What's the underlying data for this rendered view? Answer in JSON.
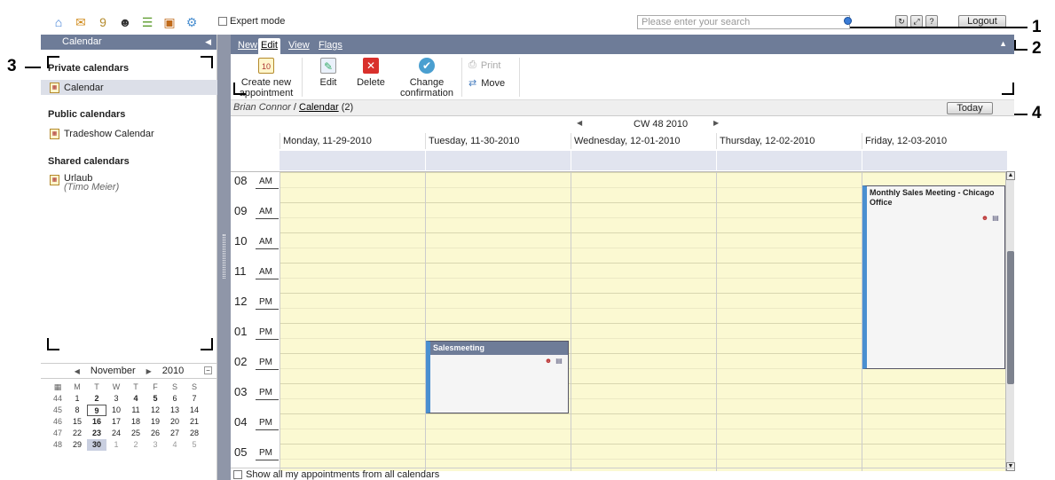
{
  "topbar": {
    "apps": [
      {
        "name": "home-icon",
        "glyph": "⌂",
        "color": "#3a7bd5"
      },
      {
        "name": "mail-icon",
        "glyph": "✉",
        "color": "#d08a1a"
      },
      {
        "name": "calendar-icon",
        "glyph": "9",
        "color": "#b48a2c"
      },
      {
        "name": "contacts-icon",
        "glyph": "☻",
        "color": "#333"
      },
      {
        "name": "tasks-icon",
        "glyph": "☰",
        "color": "#5a9a2a"
      },
      {
        "name": "infostore-icon",
        "glyph": "▣",
        "color": "#c06a1a"
      },
      {
        "name": "settings-icon",
        "glyph": "⚙",
        "color": "#4a8fd0"
      }
    ],
    "expert_mode_label": "Expert mode",
    "search_placeholder": "Please enter your search",
    "logout_label": "Logout"
  },
  "callouts": [
    "1",
    "2",
    "3",
    "4"
  ],
  "left_panel": {
    "title": "Calendar",
    "private_heading": "Private calendars",
    "private_items": [
      "Calendar"
    ],
    "public_heading": "Public calendars",
    "public_items": [
      "Tradeshow Calendar"
    ],
    "shared_heading": "Shared calendars",
    "shared_items": [
      {
        "label": "Urlaub",
        "owner": "(Timo Meier)"
      }
    ]
  },
  "mini_calendar": {
    "month": "November",
    "year": "2010",
    "weekday_labels": [
      "M",
      "T",
      "W",
      "T",
      "F",
      "S",
      "S"
    ],
    "weeks": [
      {
        "wk": "44",
        "days": [
          "1",
          "2",
          "3",
          "4",
          "5",
          "6",
          "7"
        ]
      },
      {
        "wk": "45",
        "days": [
          "8",
          "9",
          "10",
          "11",
          "12",
          "13",
          "14"
        ]
      },
      {
        "wk": "46",
        "days": [
          "15",
          "16",
          "17",
          "18",
          "19",
          "20",
          "21"
        ]
      },
      {
        "wk": "47",
        "days": [
          "22",
          "23",
          "24",
          "25",
          "26",
          "27",
          "28"
        ]
      },
      {
        "wk": "48",
        "days": [
          "29",
          "30",
          "1",
          "2",
          "3",
          "4",
          "5"
        ]
      }
    ]
  },
  "tabs": [
    "New",
    "Edit",
    "View",
    "Flags"
  ],
  "toolbar": {
    "create_label": "Create new appointment",
    "edit_label": "Edit",
    "delete_label": "Delete",
    "change_label": "Change confirmation",
    "print_label": "Print",
    "move_label": "Move",
    "create_icon_text": "10"
  },
  "breadcrumb": {
    "user": "Brian Connor",
    "separator": " / ",
    "folder": "Calendar",
    "count": " (2)"
  },
  "today_label": "Today",
  "week": {
    "label": "CW 48 2010",
    "days": [
      "Monday, 11-29-2010",
      "Tuesday, 11-30-2010",
      "Wednesday, 12-01-2010",
      "Thursday, 12-02-2010",
      "Friday, 12-03-2010"
    ]
  },
  "hours": [
    {
      "h": "08",
      "ap": "AM"
    },
    {
      "h": "09",
      "ap": "AM"
    },
    {
      "h": "10",
      "ap": "AM"
    },
    {
      "h": "11",
      "ap": "AM"
    },
    {
      "h": "12",
      "ap": "PM"
    },
    {
      "h": "01",
      "ap": "PM"
    },
    {
      "h": "02",
      "ap": "PM"
    },
    {
      "h": "03",
      "ap": "PM"
    },
    {
      "h": "04",
      "ap": "PM"
    },
    {
      "h": "05",
      "ap": "PM"
    }
  ],
  "appointments": [
    {
      "title": "Salesmeeting",
      "day": "Tuesday, 11-30-2010"
    },
    {
      "title": "Monthly Sales Meeting - Chicago Office",
      "day": "Friday, 12-03-2010"
    }
  ],
  "footer_label": "Show all my appointments from all calendars"
}
